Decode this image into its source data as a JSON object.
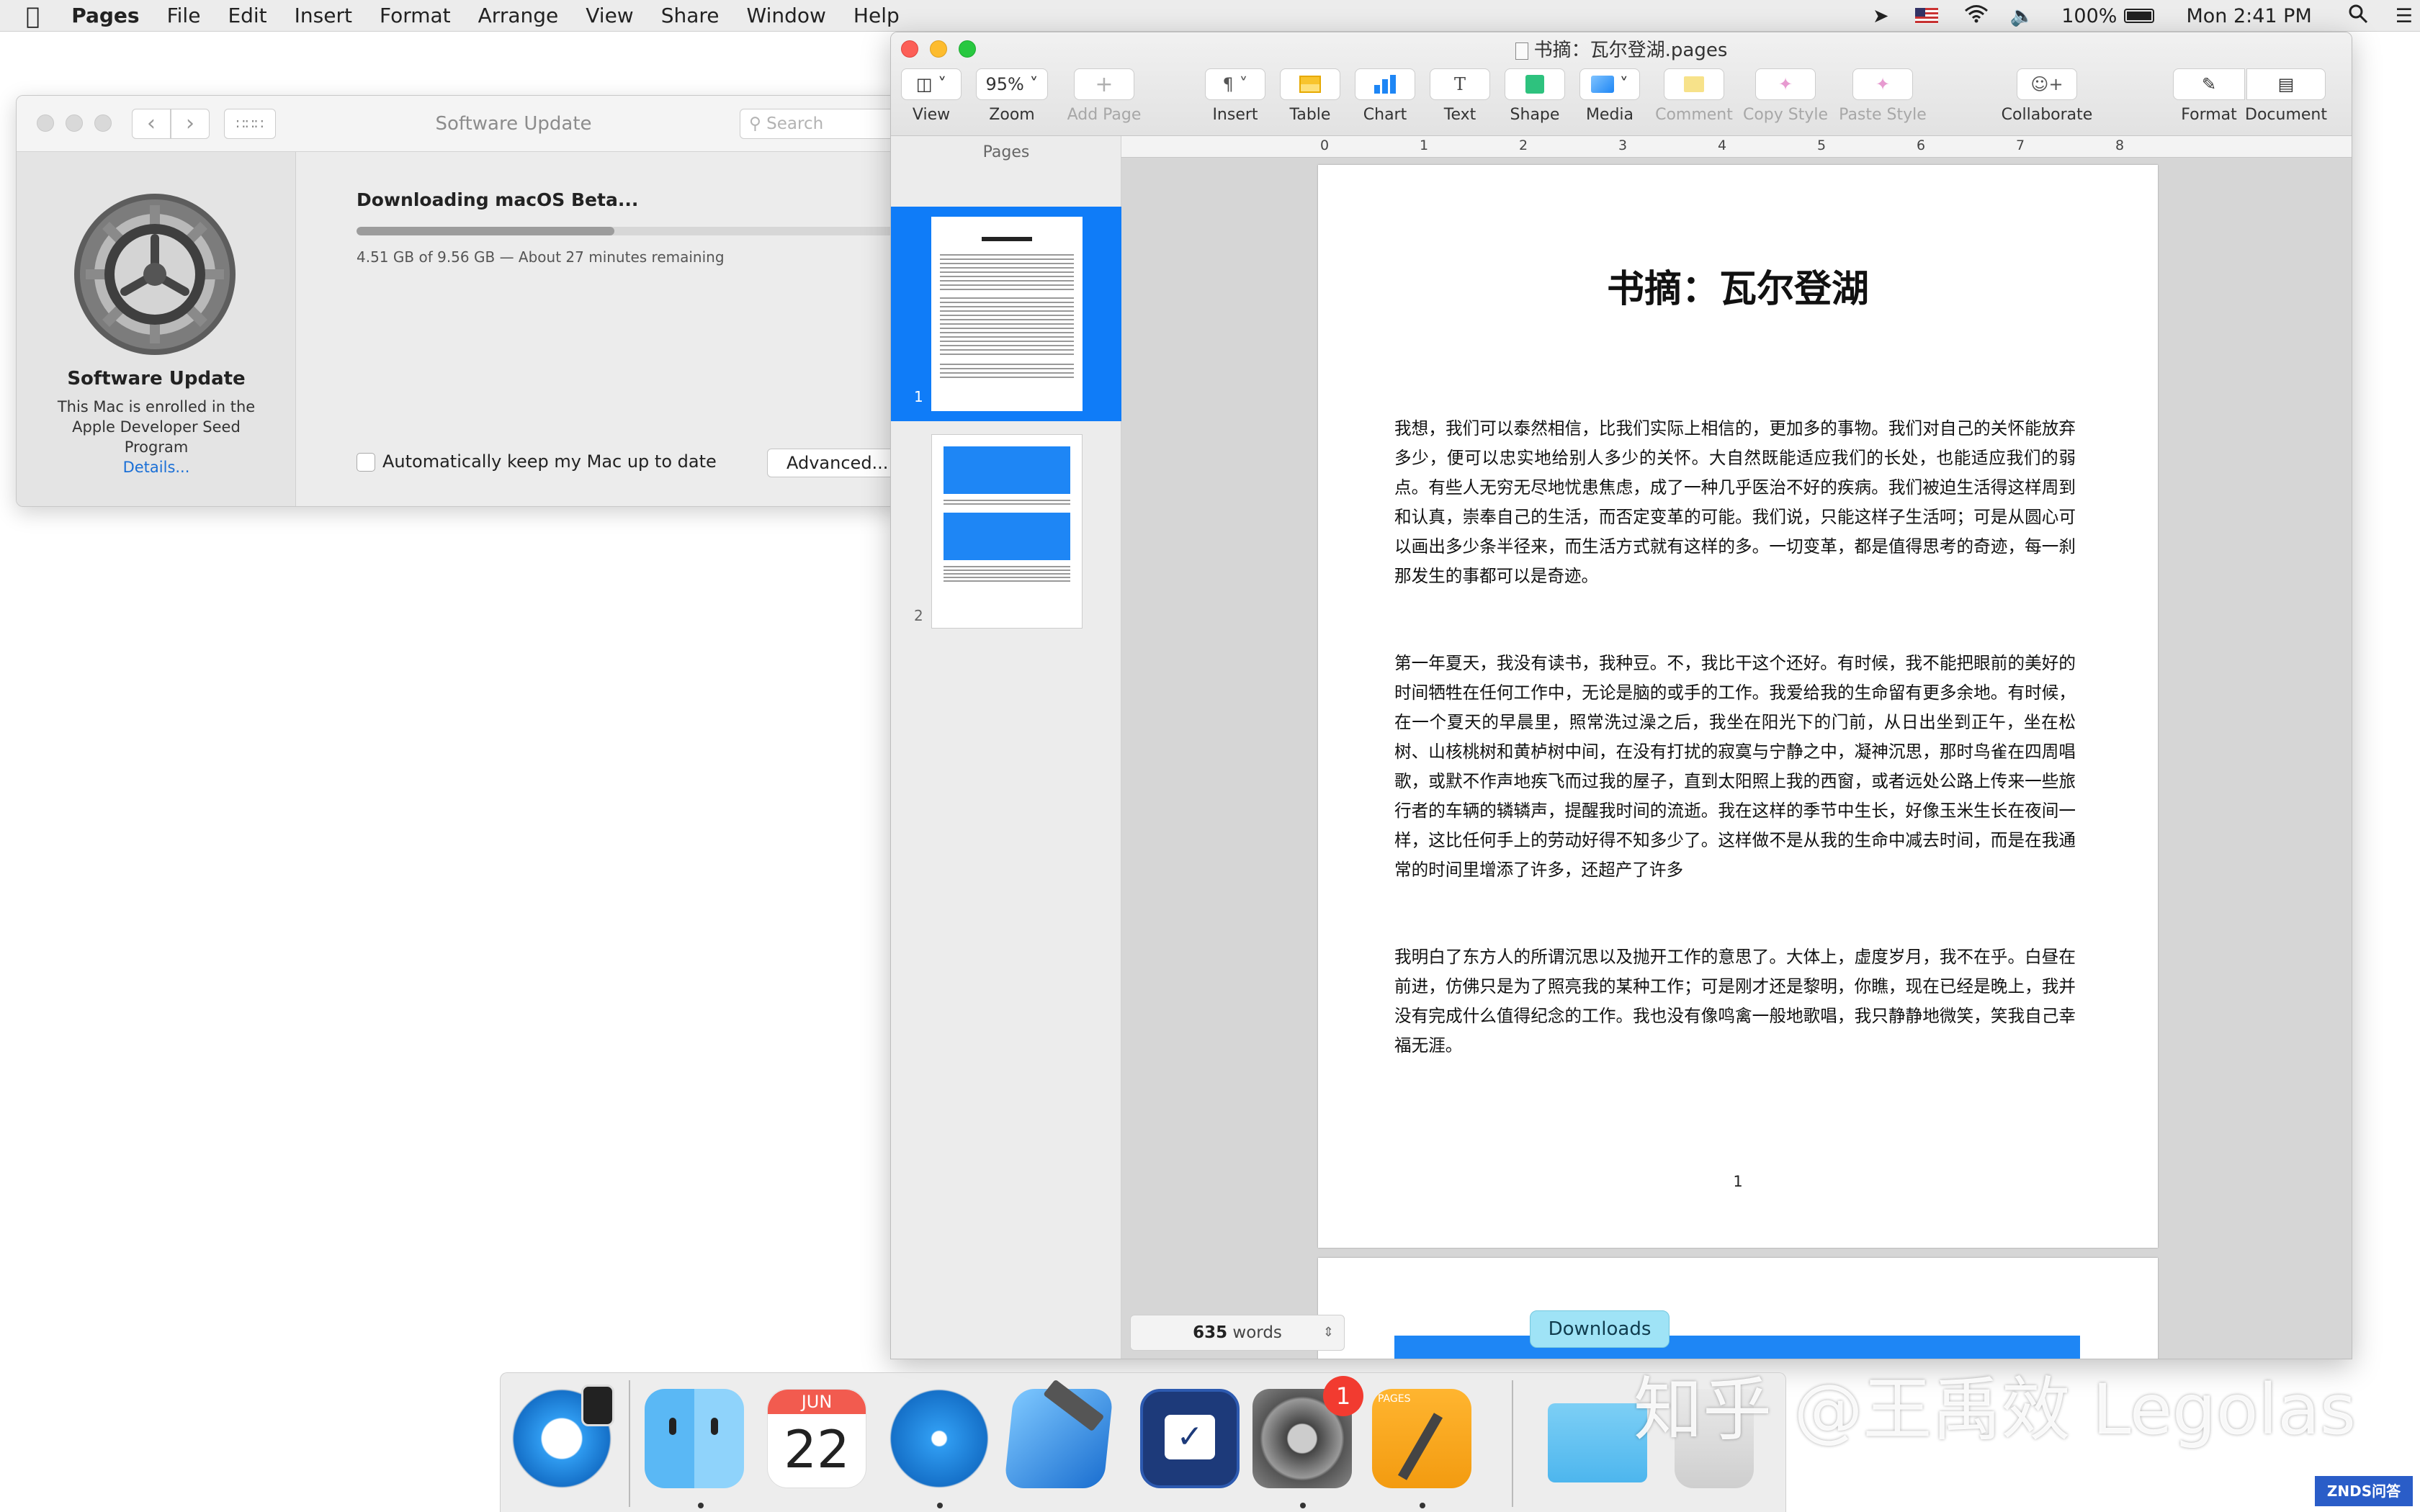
{
  "menubar": {
    "app": "Pages",
    "items": [
      "File",
      "Edit",
      "Insert",
      "Format",
      "Arrange",
      "View",
      "Share",
      "Window",
      "Help"
    ],
    "battery": "100%",
    "clock": "Mon 2:41 PM"
  },
  "software_update": {
    "title": "Software Update",
    "search_placeholder": "Search",
    "pane_title": "Software Update",
    "enrolled_text": "This Mac is enrolled in the Apple Developer Seed Program",
    "details_link": "Details...",
    "status": "Downloading macOS Beta...",
    "progress": 0.4717,
    "progress_text": "4.51 GB of 9.56 GB — About 27 minutes remaining",
    "auto_update_label": "Automatically keep my Mac up to date",
    "advanced_button": "Advanced..."
  },
  "pages": {
    "window_title": "书摘：瓦尔登湖.pages",
    "toolbar": {
      "view": "View",
      "zoom_value": "95%",
      "zoom": "Zoom",
      "add_page": "Add Page",
      "insert": "Insert",
      "table": "Table",
      "chart": "Chart",
      "text": "Text",
      "shape": "Shape",
      "media": "Media",
      "comment": "Comment",
      "copy_style": "Copy Style",
      "paste_style": "Paste Style",
      "collaborate": "Collaborate",
      "format": "Format",
      "document": "Document"
    },
    "sidebar_title": "Pages",
    "thumb1_number": "1",
    "thumb2_number": "2",
    "ruler": [
      "0",
      "1",
      "2",
      "3",
      "4",
      "5",
      "6",
      "7",
      "8"
    ],
    "doc_title": "书摘：瓦尔登湖",
    "paragraphs": [
      "我想，我们可以泰然相信，比我们实际上相信的，更加多的事物。我们对自己的关怀能放弃多少，便可以忠实地给别人多少的关怀。大自然既能适应我们的长处，也能适应我们的弱点。有些人无穷无尽地忧患焦虑，成了一种几乎医治不好的疾病。我们被迫生活得这样周到和认真，崇奉自己的生活，而否定变革的可能。我们说，只能这样子生活呵；可是从圆心可以画出多少条半径来，而生活方式就有这样的多。一切变革，都是值得思考的奇迹，每一刹那发生的事都可以是奇迹。",
      "第一年夏天，我没有读书，我种豆。不，我比干这个还好。有时候，我不能把眼前的美好的时间牺牲在任何工作中，无论是脑的或手的工作。我爱给我的生命留有更多余地。有时候，在一个夏天的早晨里，照常洗过澡之后，我坐在阳光下的门前，从日出坐到正午，坐在松树、山核桃树和黄栌树中间，在没有打扰的寂寞与宁静之中，凝神沉思，那时鸟雀在四周唱歌，或默不作声地疾飞而过我的屋子，直到太阳照上我的西窗，或者远处公路上传来一些旅行者的车辆的辚辚声，提醒我时间的流逝。我在这样的季节中生长，好像玉米生长在夜间一样，这比任何手上的劳动好得不知多少了。这样做不是从我的生命中减去时间，而是在我通常的时间里增添了许多，还超产了许多",
      "我明白了东方人的所谓沉思以及抛开工作的意思了。大体上，虚度岁月，我不在乎。白昼在前进，仿佛只是为了照亮我的某种工作；可是刚才还是黎明，你瞧，现在已经是晚上，我并没有完成什么值得纪念的工作。我也没有像鸣禽一般地歌唱，我只静静地微笑，笑我自己幸福无涯。"
    ],
    "page_number": "1",
    "word_count": "635",
    "word_label": "words"
  },
  "dock": {
    "tooltip": "Downloads",
    "calendar_month": "JUN",
    "calendar_day": "22",
    "badge": "1",
    "pages_icon_label": "PAGES",
    "apps": [
      "Simulator",
      "Finder",
      "Calendar",
      "Safari",
      "Xcode",
      "OmniFocus",
      "System Preferences",
      "Pages",
      "Downloads",
      "Trash"
    ]
  },
  "watermark": {
    "text": "知乎 @王禹效 Legolas",
    "corner": "ZNDS问答"
  },
  "colors": {
    "accent": "#1e86f5",
    "selection": "#0f7cf8",
    "progress": "#9c9c9c",
    "badge": "#f23b30"
  }
}
